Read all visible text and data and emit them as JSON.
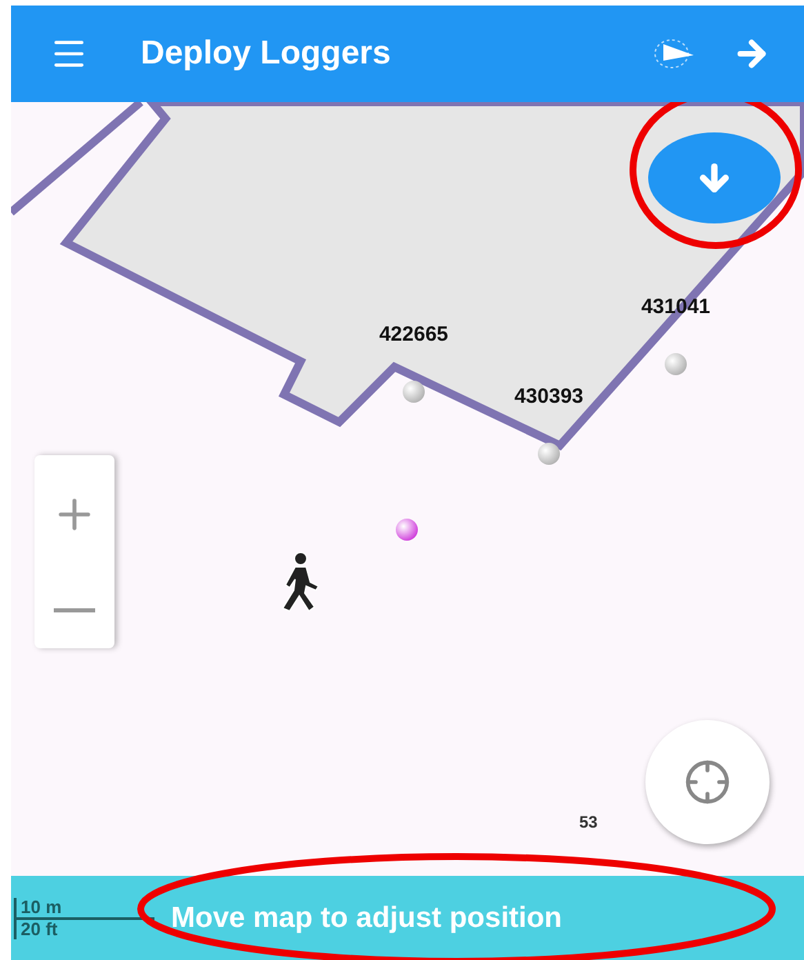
{
  "app_bar": {
    "title": "Deploy Loggers"
  },
  "map": {
    "loggers": [
      {
        "label": "422665"
      },
      {
        "label": "431041"
      },
      {
        "label": "430393"
      }
    ],
    "corner_label": "53"
  },
  "status_bar": {
    "scale": [
      "10 m",
      "20 ft"
    ],
    "message": "Move map to adjust position"
  }
}
